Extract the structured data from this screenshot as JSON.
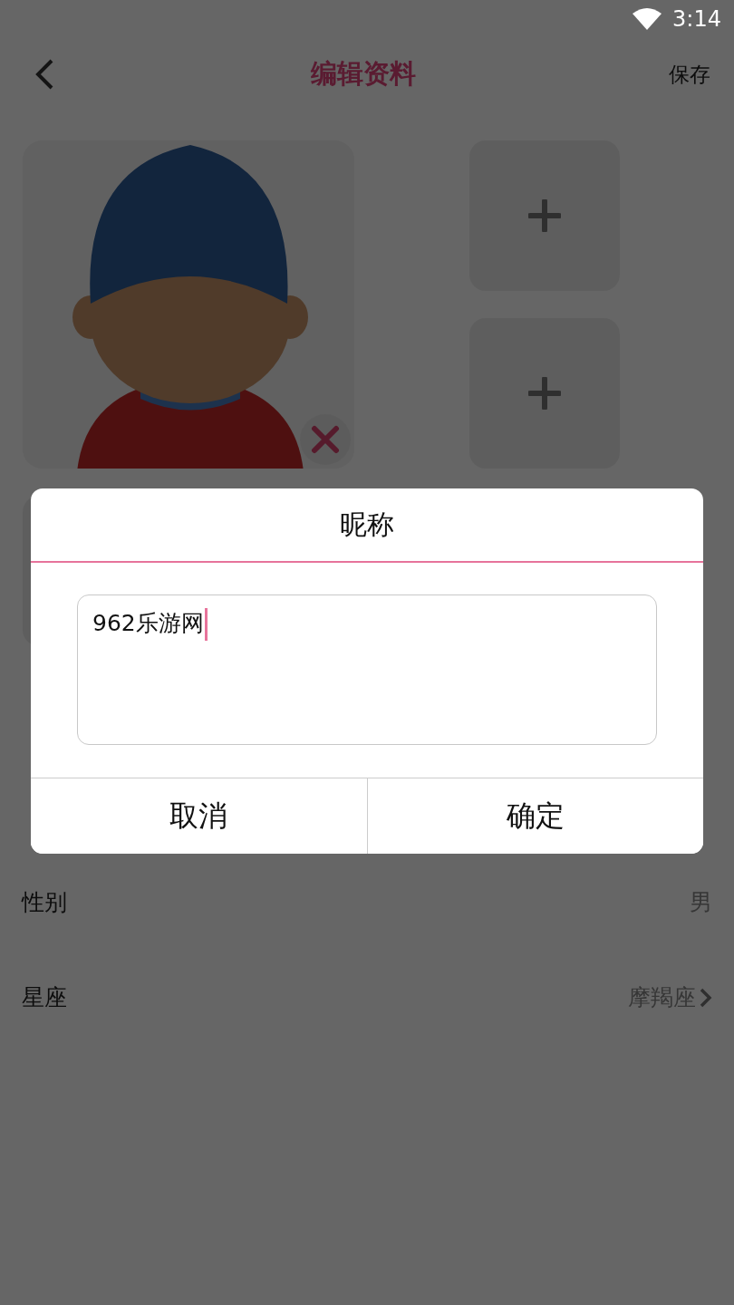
{
  "status_bar": {
    "time": "3:14"
  },
  "header": {
    "title": "编辑资料",
    "action": "保存"
  },
  "photos": [
    {
      "kind": "picture",
      "deletable": true
    },
    {
      "kind": "add"
    },
    {
      "kind": "add"
    },
    {
      "kind": "empty"
    }
  ],
  "fields": [
    {
      "label": "性别",
      "value": "男",
      "has_arrow": false
    },
    {
      "label": "星座",
      "value": "摩羯座",
      "has_arrow": true
    }
  ],
  "dialog": {
    "title": "昵称",
    "input": {
      "value": "962乐游网",
      "focused": true
    },
    "buttons": [
      "取消",
      "确定"
    ]
  }
}
